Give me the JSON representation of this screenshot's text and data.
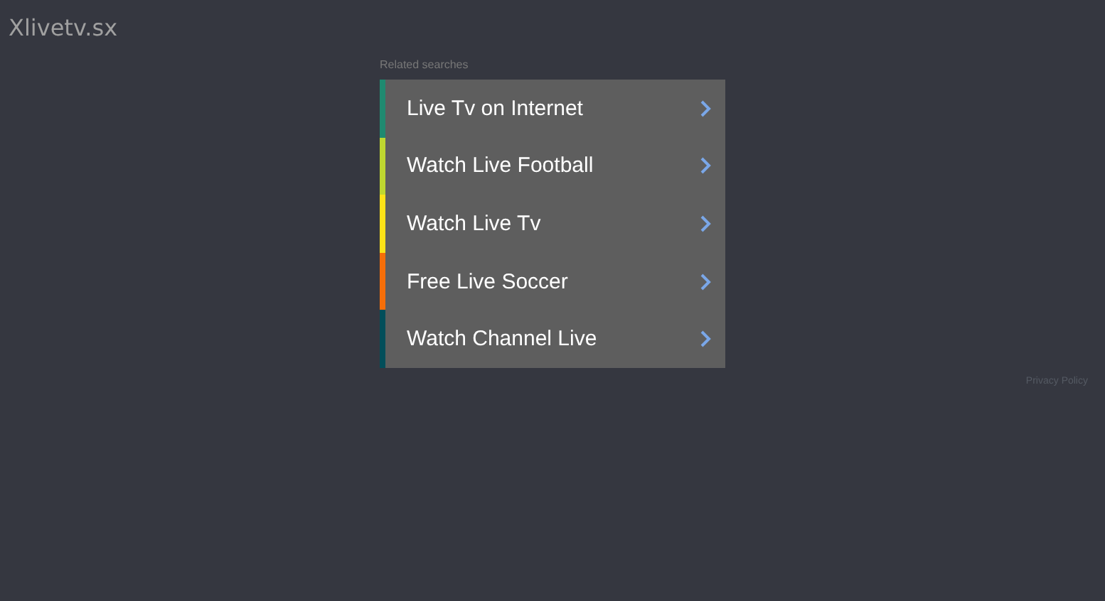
{
  "site_title": "Xlivetv.sx",
  "related_searches": {
    "heading": "Related searches",
    "items": [
      {
        "label": "Live Tv on Internet",
        "color": "#1f8a70"
      },
      {
        "label": "Watch Live Football",
        "color": "#bed730"
      },
      {
        "label": "Watch Live Tv",
        "color": "#fde218"
      },
      {
        "label": "Free Live Soccer",
        "color": "#f66e08"
      },
      {
        "label": "Watch Channel Live",
        "color": "#024e5a"
      }
    ]
  },
  "footer_link": "Privacy Policy"
}
